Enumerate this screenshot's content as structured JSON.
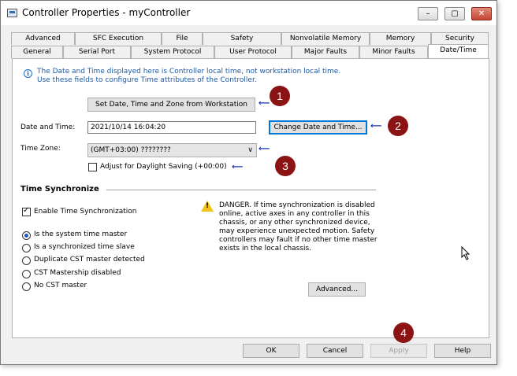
{
  "window": {
    "title": "Controller Properties - myController",
    "minimize": "–",
    "maximize": "▢",
    "close": "✕"
  },
  "tabs_row1": [
    "Advanced",
    "SFC Execution",
    "File",
    "Safety",
    "Nonvolatile Memory",
    "Memory",
    "Security"
  ],
  "tabs_row2": [
    "General",
    "Serial Port",
    "System Protocol",
    "User Protocol",
    "Major Faults",
    "Minor Faults",
    "Date/Time"
  ],
  "info": {
    "line1": "The Date and Time displayed here is Controller local time, not workstation local time.",
    "line2": "Use these fields to configure Time attributes of the Controller."
  },
  "set_from_workstation_label": "Set Date, Time and Zone from Workstation",
  "date_time": {
    "label": "Date and Time:",
    "value": "2021/10/14 16:04:20",
    "change_label": "Change Date and Time..."
  },
  "time_zone": {
    "label": "Time Zone:",
    "value": "(GMT+03:00) ????????",
    "dst_label": "Adjust for Daylight Saving (+00:00)"
  },
  "time_sync": {
    "heading": "Time Synchronize",
    "enable_label": "Enable Time Synchronization",
    "enabled": true,
    "options": [
      "Is the system time master",
      "Is a synchronized time slave",
      "Duplicate CST master detected",
      "CST Mastership disabled",
      "No CST master"
    ],
    "selected_index": 0
  },
  "danger_text": [
    "DANGER. If time synchronization is disabled",
    "online, active axes in any controller in this",
    "chassis, or any other synchronized device,",
    "may experience unexpected motion. Safety",
    "controllers may fault if no other time master",
    "exists in the local chassis."
  ],
  "advanced_label": "Advanced...",
  "footer": {
    "ok": "OK",
    "cancel": "Cancel",
    "apply": "Apply",
    "help": "Help"
  },
  "callouts": [
    "1",
    "2",
    "3",
    "4"
  ],
  "arrow_glyph": "⟵",
  "icons": {
    "info": "info-icon",
    "warning": "warning-icon",
    "dropdown": "chevron-down-icon",
    "cursor": "mouse-cursor-icon"
  },
  "colors": {
    "callout": "#8b1313",
    "arrow": "#1a33b3",
    "info_text": "#1c5aa6",
    "focus": "#0078d7"
  }
}
